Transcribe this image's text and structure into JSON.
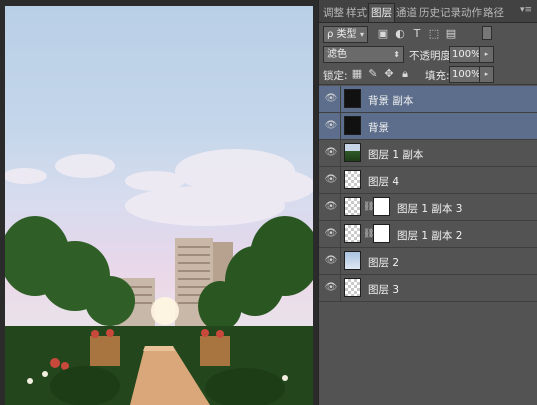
{
  "panel_tabs": [
    "调整",
    "样式",
    "图层",
    "通道",
    "历史记录",
    "动作",
    "路径"
  ],
  "active_tab": "图层",
  "filter": {
    "kind_label": "ρ 类型"
  },
  "blend": {
    "mode": "滤色",
    "opacity_label": "不透明度:",
    "opacity_value": "100%"
  },
  "lock": {
    "label": "锁定:",
    "fill_label": "填充:",
    "fill_value": "100%"
  },
  "layers": [
    {
      "name": "背景 副本",
      "thumb": "dark",
      "selected": true
    },
    {
      "name": "背景",
      "thumb": "dark",
      "selected": true
    },
    {
      "name": "图层 1 副本",
      "thumb": "tree",
      "selected": false
    },
    {
      "name": "图层 4",
      "thumb": "checker",
      "selected": false
    },
    {
      "name": "图层 1 副本 3",
      "thumb": "checker",
      "mask": true,
      "selected": false
    },
    {
      "name": "图层 1 副本 2",
      "thumb": "checker",
      "mask": true,
      "selected": false
    },
    {
      "name": "图层 2",
      "thumb": "sky",
      "selected": false
    },
    {
      "name": "图层 3",
      "thumb": "checker",
      "selected": false
    }
  ],
  "icons": {
    "eye": "eye-icon",
    "link": "chain-link-icon",
    "menu": "panel-menu-icon"
  },
  "colors": {
    "selection": "#5c6e8c",
    "panel": "#535353",
    "tabbar": "#424242"
  }
}
